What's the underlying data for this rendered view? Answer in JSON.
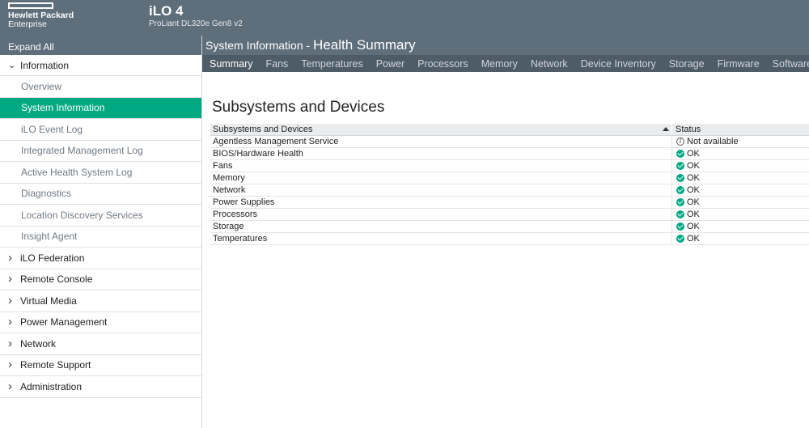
{
  "brand": {
    "line1": "Hewlett Packard",
    "line2": "Enterprise"
  },
  "product": {
    "name": "iLO 4",
    "model": "ProLiant DL320e Gen8 v2"
  },
  "sidebar": {
    "expand_all": "Expand All",
    "items": [
      {
        "label": "Information",
        "level": "top",
        "expanded": true,
        "icon": "chevron-down-icon"
      },
      {
        "label": "Overview",
        "level": "sub"
      },
      {
        "label": "System Information",
        "level": "sub",
        "active": true
      },
      {
        "label": "iLO Event Log",
        "level": "sub"
      },
      {
        "label": "Integrated Management Log",
        "level": "sub"
      },
      {
        "label": "Active Health System Log",
        "level": "sub"
      },
      {
        "label": "Diagnostics",
        "level": "sub"
      },
      {
        "label": "Location Discovery Services",
        "level": "sub"
      },
      {
        "label": "Insight Agent",
        "level": "sub"
      },
      {
        "label": "iLO Federation",
        "level": "top",
        "icon": "chevron-right-icon"
      },
      {
        "label": "Remote Console",
        "level": "top",
        "icon": "chevron-right-icon"
      },
      {
        "label": "Virtual Media",
        "level": "top",
        "icon": "chevron-right-icon"
      },
      {
        "label": "Power Management",
        "level": "top",
        "icon": "chevron-right-icon"
      },
      {
        "label": "Network",
        "level": "top",
        "icon": "chevron-right-icon"
      },
      {
        "label": "Remote Support",
        "level": "top",
        "icon": "chevron-right-icon"
      },
      {
        "label": "Administration",
        "level": "top",
        "icon": "chevron-right-icon"
      }
    ]
  },
  "page_title": {
    "prefix": "System Information - ",
    "main": "Health Summary"
  },
  "tabs": [
    "Summary",
    "Fans",
    "Temperatures",
    "Power",
    "Processors",
    "Memory",
    "Network",
    "Device Inventory",
    "Storage",
    "Firmware",
    "Software"
  ],
  "active_tab": "Summary",
  "section_heading": "Subsystems and Devices",
  "table": {
    "columns": [
      "Subsystems and Devices",
      "Status"
    ],
    "sort": "ascending",
    "rows": [
      {
        "name": "Agentless Management Service",
        "status": "Not available",
        "icon": "info-icon"
      },
      {
        "name": "BIOS/Hardware Health",
        "status": "OK",
        "icon": "ok-check-icon"
      },
      {
        "name": "Fans",
        "status": "OK",
        "icon": "ok-check-icon"
      },
      {
        "name": "Memory",
        "status": "OK",
        "icon": "ok-check-icon"
      },
      {
        "name": "Network",
        "status": "OK",
        "icon": "ok-check-icon"
      },
      {
        "name": "Power Supplies",
        "status": "OK",
        "icon": "ok-check-icon"
      },
      {
        "name": "Processors",
        "status": "OK",
        "icon": "ok-check-icon"
      },
      {
        "name": "Storage",
        "status": "OK",
        "icon": "ok-check-icon"
      },
      {
        "name": "Temperatures",
        "status": "OK",
        "icon": "ok-check-icon"
      }
    ]
  },
  "colors": {
    "header": "#5f6e7b",
    "tabs": "#4e5c68",
    "accent": "#01a982"
  }
}
